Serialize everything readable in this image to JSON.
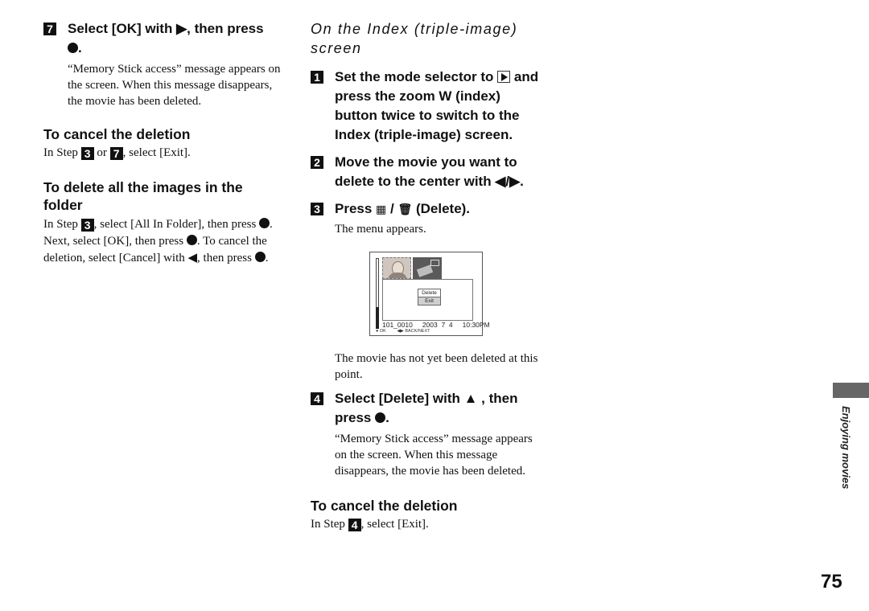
{
  "left_column": {
    "step7": {
      "number": "7",
      "heading": "Select [OK] with ▶, then press",
      "heading_end": ".",
      "body": "“Memory Stick access” message appears on the screen. When this message disappears, the movie has been deleted."
    },
    "cancel": {
      "heading": "To cancel the deletion",
      "text_prefix": "In Step ",
      "step_a": "3",
      "text_mid": " or ",
      "step_b": "7",
      "text_suffix": ", select [Exit]."
    },
    "delete_all": {
      "heading": "To delete all the images in the folder",
      "text_prefix": "In Step ",
      "step": "3",
      "text_1": ", select [All In Folder], then press ",
      "text_2": ". Next, select [OK], then press ",
      "text_3": ". To cancel the deletion, select [Cancel] with ◀, then press ",
      "text_4": "."
    }
  },
  "right_column": {
    "section_title": "On the Index (triple-image) screen",
    "step1": {
      "number": "1",
      "heading_a": "Set the mode selector to ",
      "heading_b": " and press the zoom W (index) button twice to switch to the Index (triple-image) screen."
    },
    "step2": {
      "number": "2",
      "heading": "Move the movie you want to delete to the center with ◀/▶."
    },
    "step3": {
      "number": "3",
      "heading_a": "Press ",
      "index_glyph": "▦",
      "separator": " / ",
      "trash_glyph": "🗑",
      "heading_b": " (Delete).",
      "body": "The menu appears."
    },
    "lcd": {
      "menu_items": [
        "Delete",
        "Exit"
      ],
      "selected": "Exit",
      "folder_file": "101_0010",
      "date": "2003  7  4",
      "time": "10:30PM",
      "hint_ok": "● OK",
      "hint_nav": "◀▶ BACK/NEXT"
    },
    "note": "The movie has not yet been deleted at this point.",
    "step4": {
      "number": "4",
      "heading": "Select [Delete] with ▲ , then press",
      "heading_end": ".",
      "body": "“Memory Stick access” message appears on the screen. When this message disappears, the movie has been deleted."
    },
    "cancel": {
      "heading": "To cancel the deletion",
      "text_prefix": "In Step ",
      "step": "4",
      "text_suffix": ", select [Exit]."
    }
  },
  "side_label": "Enjoying movies",
  "page_number": "75"
}
